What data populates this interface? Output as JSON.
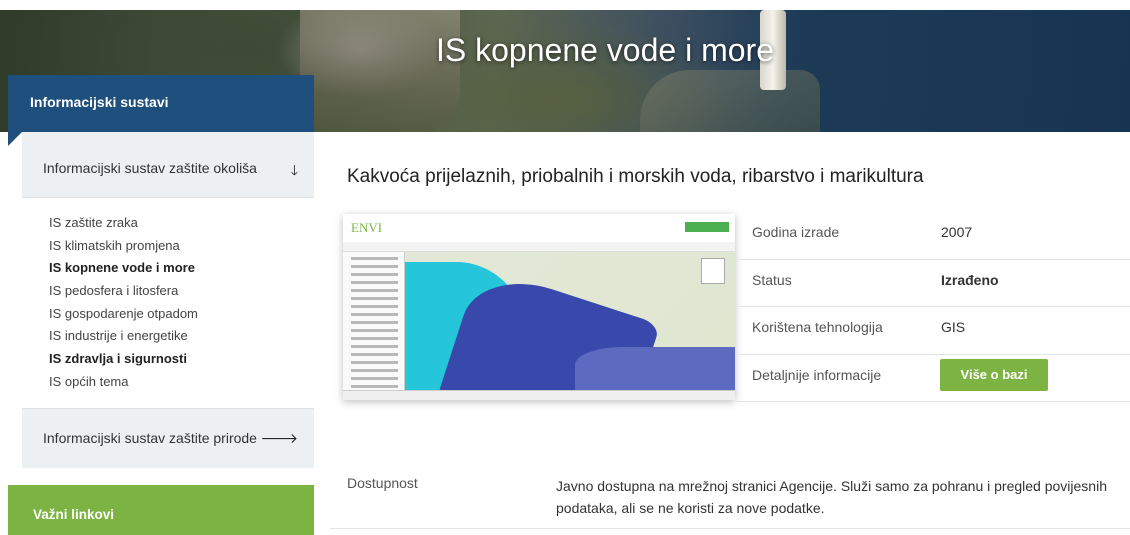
{
  "hero": {
    "title": "IS kopnene vode i more"
  },
  "sidebar": {
    "header": "Informacijski sustavi",
    "sections": [
      {
        "label": "Informacijski sustav zaštite okoliša",
        "arrow": "🡓"
      },
      {
        "label": "Informacijski sustav zaštite prirode",
        "arrow": "🡒"
      }
    ],
    "items": [
      {
        "label": "IS zaštite zraka"
      },
      {
        "label": "IS klimatskih promjena"
      },
      {
        "label": "IS kopnene vode i more"
      },
      {
        "label": "IS pedosfera i litosfera"
      },
      {
        "label": "IS gospodarenje otpadom"
      },
      {
        "label": "IS industrije i energetike"
      },
      {
        "label": "IS zdravlja i sigurnosti"
      },
      {
        "label": "IS općih tema"
      }
    ],
    "links_header": "Važni linkovi"
  },
  "main": {
    "title": "Kakvoća prijelaznih, priobalnih i morskih voda, ribarstvo i marikultura",
    "preview": {
      "logo": "ENVI"
    },
    "info": [
      {
        "key": "Godina izrade",
        "value": "2007"
      },
      {
        "key": "Status",
        "value": "Izrađeno"
      },
      {
        "key": "Korištena tehnologija",
        "value": "GIS"
      },
      {
        "key": "Detaljnije informacije",
        "button": "Više o bazi"
      }
    ],
    "availability": {
      "key": "Dostupnost",
      "value": "Javno dostupna na mrežnoj stranici Agencije. Služi samo za pohranu i pregled povijesnih podataka, ali se ne koristi za nove podatke."
    }
  }
}
